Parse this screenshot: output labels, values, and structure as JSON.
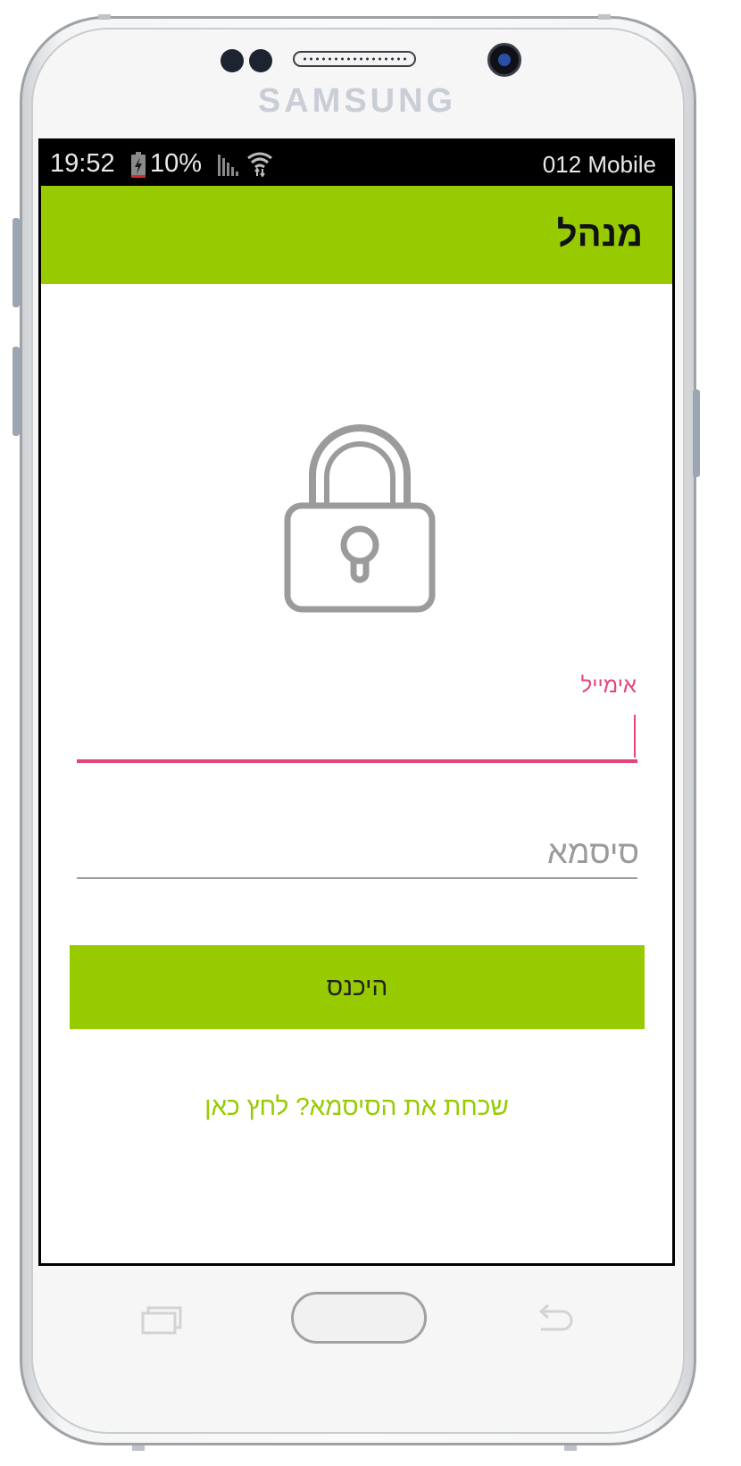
{
  "device": {
    "brand": "SAMSUNG"
  },
  "status_bar": {
    "time": "19:52",
    "battery": "10%",
    "carrier": "012 Mobile"
  },
  "app_bar": {
    "title": "מנהל"
  },
  "login_form": {
    "email_label": "אימייל",
    "email_value": "",
    "password_placeholder": "סיסמא",
    "password_value": "",
    "submit_label": "היכנס",
    "forgot_link": "שכחת את הסיסמא? לחץ כאן"
  },
  "icons": {
    "lock": "lock-icon",
    "battery": "battery-charging-icon",
    "signal": "cell-signal-icon",
    "wifi": "wifi-icon"
  },
  "colors": {
    "accent_green": "#97cb00",
    "focus_pink": "#e8447c",
    "lock_gray": "#9b9b9b"
  }
}
